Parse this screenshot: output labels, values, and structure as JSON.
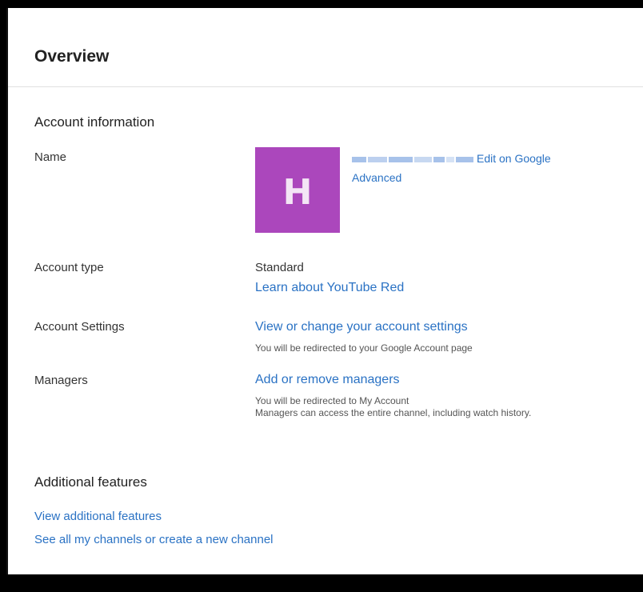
{
  "header": {
    "title": "Overview"
  },
  "account_information": {
    "title": "Account information",
    "name": {
      "label": "Name",
      "avatar_letter": "H",
      "avatar_color": "#ab47bc",
      "edit_link": "Edit on Google",
      "advanced_link": "Advanced"
    },
    "account_type": {
      "label": "Account type",
      "value": "Standard",
      "link": "Learn about YouTube Red"
    },
    "account_settings": {
      "label": "Account Settings",
      "link": "View or change your account settings",
      "note": "You will be redirected to your Google Account page"
    },
    "managers": {
      "label": "Managers",
      "link": "Add or remove managers",
      "note_1": "You will be redirected to My Account",
      "note_2": "Managers can access the entire channel, including watch history."
    }
  },
  "additional_features": {
    "title": "Additional features",
    "links": [
      "View additional features",
      "See all my channels or create a new channel"
    ]
  },
  "colors": {
    "link": "#2a72c4",
    "divider": "#e0e0e0"
  }
}
